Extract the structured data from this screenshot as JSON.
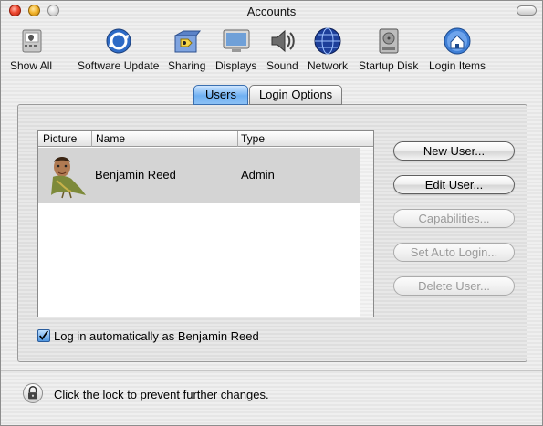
{
  "window": {
    "title": "Accounts"
  },
  "toolbar": {
    "items": [
      {
        "label": "Show All",
        "icon": "show-all-icon"
      },
      {
        "label": "Software Update",
        "icon": "software-update-icon"
      },
      {
        "label": "Sharing",
        "icon": "sharing-icon"
      },
      {
        "label": "Displays",
        "icon": "displays-icon"
      },
      {
        "label": "Sound",
        "icon": "sound-icon"
      },
      {
        "label": "Network",
        "icon": "network-icon"
      },
      {
        "label": "Startup Disk",
        "icon": "startup-disk-icon"
      },
      {
        "label": "Login Items",
        "icon": "login-items-icon"
      }
    ]
  },
  "tabs": [
    {
      "label": "Users",
      "active": true
    },
    {
      "label": "Login Options",
      "active": false
    }
  ],
  "table": {
    "columns": [
      "Picture",
      "Name",
      "Type"
    ],
    "rows": [
      {
        "name": "Benjamin Reed",
        "type": "Admin",
        "selected": true
      }
    ]
  },
  "buttons": {
    "new_user": "New User...",
    "edit_user": "Edit User...",
    "capabilities": "Capabilities...",
    "set_auto_login": "Set Auto Login...",
    "delete_user": "Delete User..."
  },
  "auto_login": {
    "checked": true,
    "label": "Log in automatically as Benjamin Reed"
  },
  "lock": {
    "text": "Click the lock to prevent further changes."
  },
  "colors": {
    "active_tab": "#6fb0f2",
    "selected_row": "#d4d4d4",
    "checkbox": "#4f96e0"
  }
}
